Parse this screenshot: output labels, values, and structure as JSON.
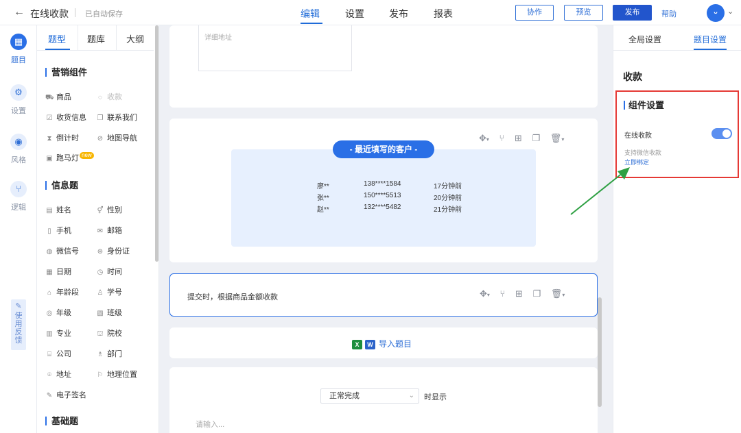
{
  "header": {
    "back_icon": "arrow-left-icon",
    "app_name": "在线收款",
    "save_status": "已自动保存",
    "nav_tabs": [
      "编辑",
      "设置",
      "发布",
      "报表"
    ],
    "active_tab": "编辑",
    "collab_label": "协作",
    "preview_label": "预览",
    "publish_label": "发布",
    "help_label": "帮助",
    "avatar_text": "ὤ"
  },
  "rail": {
    "items": [
      {
        "label": "题目",
        "icon": "grid-icon"
      },
      {
        "label": "设置",
        "icon": "gear-icon"
      },
      {
        "label": "风格",
        "icon": "palette-icon"
      },
      {
        "label": "逻辑",
        "icon": "logic-icon"
      }
    ],
    "feedback_label": "使用反馈"
  },
  "left_panel": {
    "tabs": [
      "题型",
      "题库",
      "大纲"
    ],
    "active_tab": "题型",
    "sections": [
      {
        "title": "营销组件",
        "items": [
          {
            "label": "商品",
            "icon": "cart-icon"
          },
          {
            "label": "收款",
            "icon": "payment-icon",
            "disabled": true
          },
          {
            "label": "收货信息",
            "icon": "checkbox-icon"
          },
          {
            "label": "联系我们",
            "icon": "chat-icon"
          },
          {
            "label": "倒计时",
            "icon": "hourglass-icon"
          },
          {
            "label": "地图导航",
            "icon": "compass-icon"
          },
          {
            "label": "跑马灯",
            "icon": "marquee-icon",
            "badge": "new"
          }
        ]
      },
      {
        "title": "信息题",
        "items": [
          {
            "label": "姓名",
            "icon": "id-icon"
          },
          {
            "label": "性别",
            "icon": "gender-icon"
          },
          {
            "label": "手机",
            "icon": "phone-icon"
          },
          {
            "label": "邮箱",
            "icon": "mail-icon"
          },
          {
            "label": "微信号",
            "icon": "wechat-icon"
          },
          {
            "label": "身份证",
            "icon": "idcard-icon"
          },
          {
            "label": "日期",
            "icon": "calendar-icon"
          },
          {
            "label": "时间",
            "icon": "clock-icon"
          },
          {
            "label": "年龄段",
            "icon": "age-icon"
          },
          {
            "label": "学号",
            "icon": "student-icon"
          },
          {
            "label": "年级",
            "icon": "grade-icon"
          },
          {
            "label": "班级",
            "icon": "class-icon"
          },
          {
            "label": "专业",
            "icon": "major-icon"
          },
          {
            "label": "院校",
            "icon": "school-icon"
          },
          {
            "label": "公司",
            "icon": "company-icon"
          },
          {
            "label": "部门",
            "icon": "department-icon"
          },
          {
            "label": "地址",
            "icon": "location-icon"
          },
          {
            "label": "地理位置",
            "icon": "flag-icon"
          },
          {
            "label": "电子签名",
            "icon": "pen-icon"
          }
        ]
      },
      {
        "title": "基础题",
        "items": []
      }
    ]
  },
  "canvas": {
    "address_placeholder": "详细地址",
    "recent_title": "- 最近填写的客户 -",
    "recent_rows": [
      {
        "name": "廖**",
        "phone": "138****1584",
        "time": "17分钟前"
      },
      {
        "name": "张**",
        "phone": "150****5513",
        "time": "20分钟前"
      },
      {
        "name": "赵**",
        "phone": "132****5482",
        "time": "21分钟前"
      }
    ],
    "submit_text": "提交时，根据商品金额收款",
    "import_label": "导入题目",
    "select_value": "正常完成",
    "show_text": "时显示",
    "input_placeholder": "请输入..."
  },
  "right_panel": {
    "tabs": [
      "全局设置",
      "题目设置"
    ],
    "active_tab": "题目设置",
    "title": "收款",
    "component_settings": "组件设置",
    "online_payment_label": "在线收款",
    "online_payment_on": true,
    "wechat_note": "支持微信收款",
    "bind_link": "立即绑定"
  },
  "colors": {
    "accent": "#2a6fe6",
    "highlight_box": "#e53935",
    "arrow": "#2ea043"
  }
}
